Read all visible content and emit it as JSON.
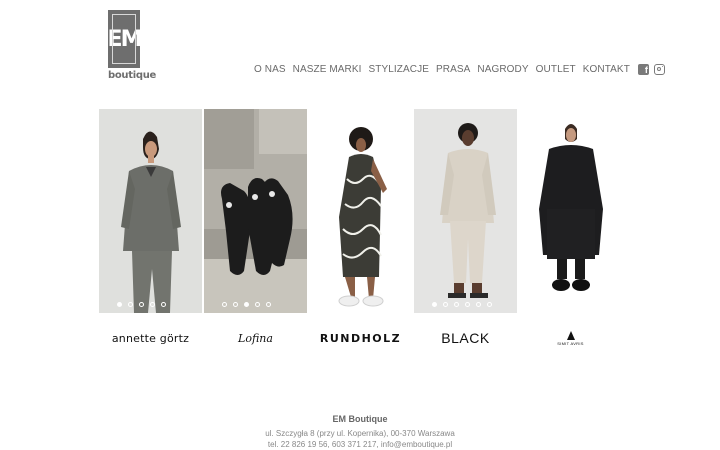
{
  "logo": {
    "mark": "EM",
    "word": "boutique"
  },
  "nav": {
    "items": [
      "O NAS",
      "NASZE MARKI",
      "STYLIZACJE",
      "PRASA",
      "NAGRODY",
      "OUTLET",
      "KONTAKT"
    ],
    "facebook_icon": "facebook-icon",
    "instagram_icon": "instagram-icon"
  },
  "slides": [
    {
      "image": "woman in grey jacket and trousers",
      "active_dot": 1
    },
    {
      "image": "black mesh sandals on stone",
      "active_dot": 3
    },
    {
      "image": "woman in black and white patterned dress",
      "active_dot": 1
    },
    {
      "image": "man in beige outfit",
      "active_dot": 1
    },
    {
      "image": "woman in long black coat",
      "active_dot": 1
    }
  ],
  "brands": [
    "annette görtz",
    "Lofina",
    "RUNDHOLZ",
    "BLACK",
    "SIMIT AVRIS"
  ],
  "footer": {
    "title": "EM Boutique",
    "address": "ul. Szczygła 8 (przy ul. Kopernika), 00-370 Warszawa",
    "contact": "tel. 22 826 19 56, 603 371 217, info@emboutique.pl"
  },
  "colors": {
    "text": "#6a6a6a",
    "logo": "#6e6e6e",
    "footer_text": "#888888"
  }
}
